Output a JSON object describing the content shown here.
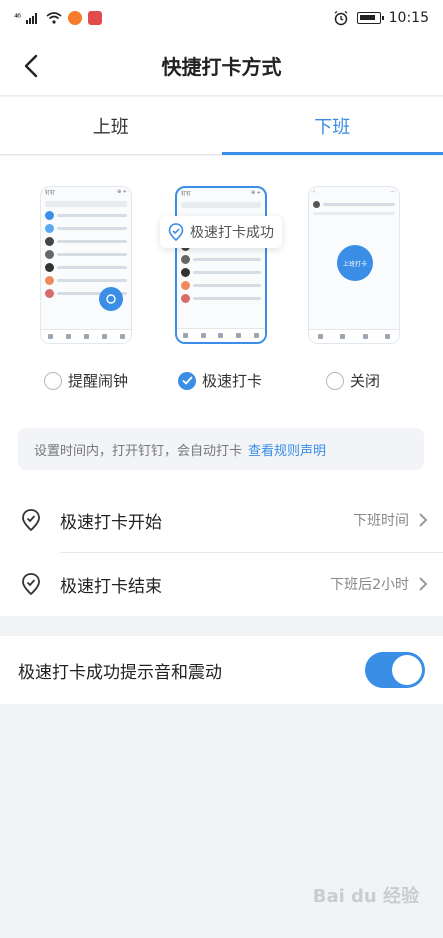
{
  "status_bar": {
    "signal": "⁴⁶",
    "time": "10:15"
  },
  "navbar": {
    "title": "快捷打卡方式"
  },
  "tabs": [
    {
      "label": "上班",
      "active": false
    },
    {
      "label": "下班",
      "active": true
    }
  ],
  "preview": {
    "toast": "极速打卡成功",
    "phone1_title": "钉钉",
    "phone2_title": "钉钉",
    "phone3_btn": "上班打卡"
  },
  "options": [
    {
      "label": "提醒闹钟",
      "checked": false
    },
    {
      "label": "极速打卡",
      "checked": true
    },
    {
      "label": "关闭",
      "checked": false
    }
  ],
  "tip": {
    "text": "设置时间内，打开钉钉，会自动打卡",
    "link": "查看规则声明"
  },
  "settings": [
    {
      "label": "极速打卡开始",
      "value": "下班时间"
    },
    {
      "label": "极速打卡结束",
      "value": "下班后2小时"
    }
  ],
  "toggle_setting": {
    "label": "极速打卡成功提示音和震动",
    "on": true
  },
  "watermark": "Bai du 经验",
  "colors": {
    "accent": "#3a8ee6"
  }
}
